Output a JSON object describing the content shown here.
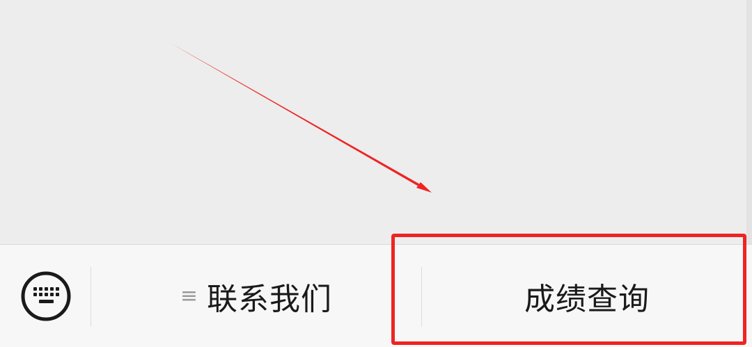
{
  "colors": {
    "chat_background": "#ededed",
    "menu_background": "#f7f7f7",
    "annotation_red": "#ee2424",
    "text": "#1a1a1a"
  },
  "menu": {
    "keyboard_icon": "keyboard-icon",
    "items": [
      {
        "label": "联系我们",
        "icon": "menu-lines-icon"
      },
      {
        "label": "成绩查询"
      }
    ]
  },
  "annotations": {
    "arrow": "arrow-annotation",
    "highlight": "highlight-box"
  }
}
